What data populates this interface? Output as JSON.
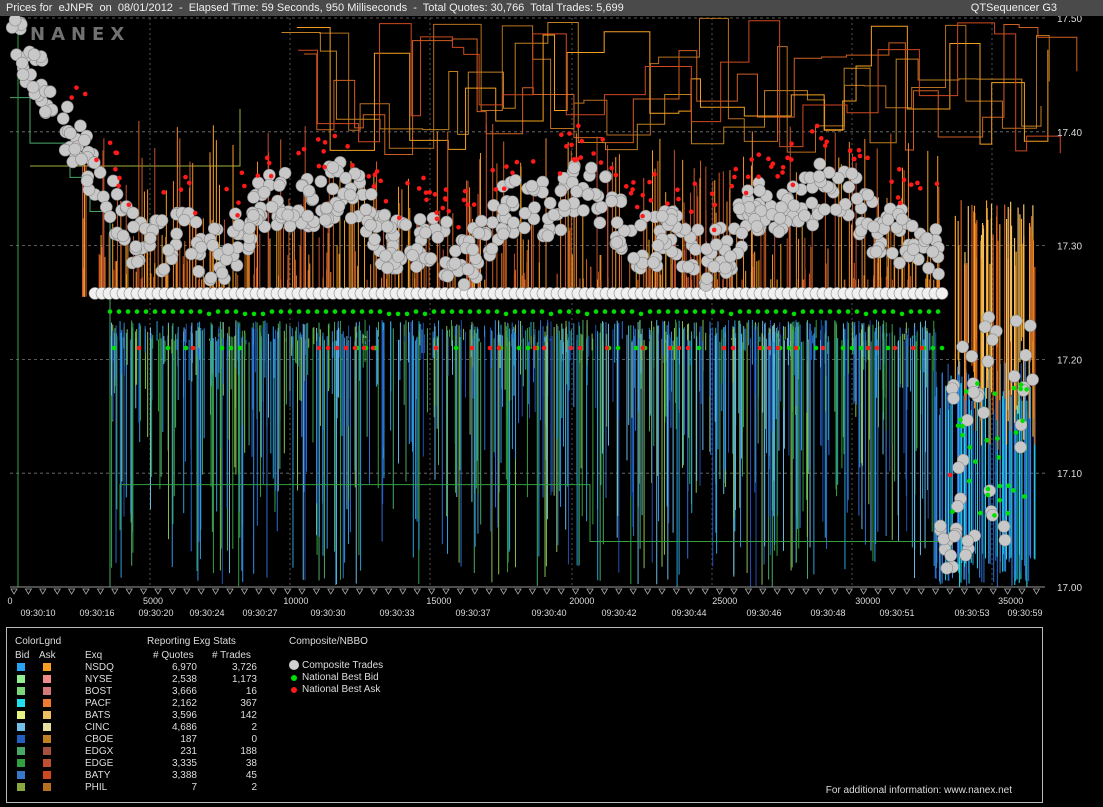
{
  "header": {
    "title": "Prices for  eJNPR  on  08/01/2012  -  Elapsed Time: 59 Seconds, 950 Milliseconds  -  Total Quotes: 30,766  Total Trades: 5,699",
    "app_name": "QTSequencer G3",
    "watermark": "NANEX"
  },
  "chart_data": {
    "type": "scatter",
    "title": "Prices for eJNPR on 08/01/2012",
    "y_ticks": [
      "17.50",
      "17.40",
      "17.30",
      "17.20",
      "17.10",
      "17.00"
    ],
    "ylim": [
      17.0,
      17.5
    ],
    "x_count_ticks": [
      "0",
      "5000",
      "10000",
      "15000",
      "20000",
      "25000",
      "30000",
      "35000"
    ],
    "x_time_labels": [
      "09:30:10",
      "09:30:16",
      "09:30:20",
      "09:30:24",
      "09:30:27",
      "09:30:30",
      "09:30:33",
      "09:30:37",
      "09:30:40",
      "09:30:42",
      "09:30:44",
      "09:30:46",
      "09:30:48",
      "09:30:51",
      "09:30:53",
      "09:30:59"
    ],
    "xlim": [
      0,
      36200
    ],
    "grid": true,
    "series": [
      {
        "name": "Composite Trades",
        "color": "#c8c8c8"
      },
      {
        "name": "National Best Bid",
        "color": "#00e000"
      },
      {
        "name": "National Best Ask",
        "color": "#ff1a1a"
      }
    ]
  },
  "legend": {
    "color_legend_title": "ColorLgnd",
    "bid_label": "Bid",
    "ask_label": "Ask",
    "stats_title": "Reporting Exg Stats",
    "exq_label": "Exq",
    "quotes_label": "# Quotes",
    "trades_label": "# Trades",
    "composite_title": "Composite/NBBO",
    "composite": [
      {
        "label": "Composite Trades",
        "color": "#d0d0d0"
      },
      {
        "label": "National Best Bid",
        "color": "#00e000"
      },
      {
        "label": "National Best Ask",
        "color": "#ff1a1a"
      }
    ],
    "exchanges": [
      {
        "name": "NSDQ",
        "quotes": "6,970",
        "trades": "3,726",
        "bid_color": "#29a3f2",
        "ask_color": "#f5a020"
      },
      {
        "name": "NYSE",
        "quotes": "2,538",
        "trades": "1,173",
        "bid_color": "#90f090",
        "ask_color": "#f08a8a"
      },
      {
        "name": "BOST",
        "quotes": "3,666",
        "trades": "16",
        "bid_color": "#78d878",
        "ask_color": "#d67878"
      },
      {
        "name": "PACF",
        "quotes": "2,162",
        "trades": "367",
        "bid_color": "#20e0f0",
        "ask_color": "#f07a30"
      },
      {
        "name": "BATS",
        "quotes": "3,596",
        "trades": "142",
        "bid_color": "#e8f080",
        "ask_color": "#f0c060"
      },
      {
        "name": "CINC",
        "quotes": "4,686",
        "trades": "2",
        "bid_color": "#70c0e8",
        "ask_color": "#e8e0a0"
      },
      {
        "name": "CBOE",
        "quotes": "187",
        "trades": "0",
        "bid_color": "#2060c0",
        "ask_color": "#c08020"
      },
      {
        "name": "EDGX",
        "quotes": "231",
        "trades": "188",
        "bid_color": "#48a868",
        "ask_color": "#a85040"
      },
      {
        "name": "EDGE",
        "quotes": "3,335",
        "trades": "38",
        "bid_color": "#30a040",
        "ask_color": "#c05030"
      },
      {
        "name": "BATY",
        "quotes": "3,388",
        "trades": "45",
        "bid_color": "#3878c8",
        "ask_color": "#d04820"
      },
      {
        "name": "PHIL",
        "quotes": "7",
        "trades": "2",
        "bid_color": "#88a840",
        "ask_color": "#b87020"
      }
    ]
  },
  "footer": {
    "info": "For additional information: www.nanex.net"
  }
}
